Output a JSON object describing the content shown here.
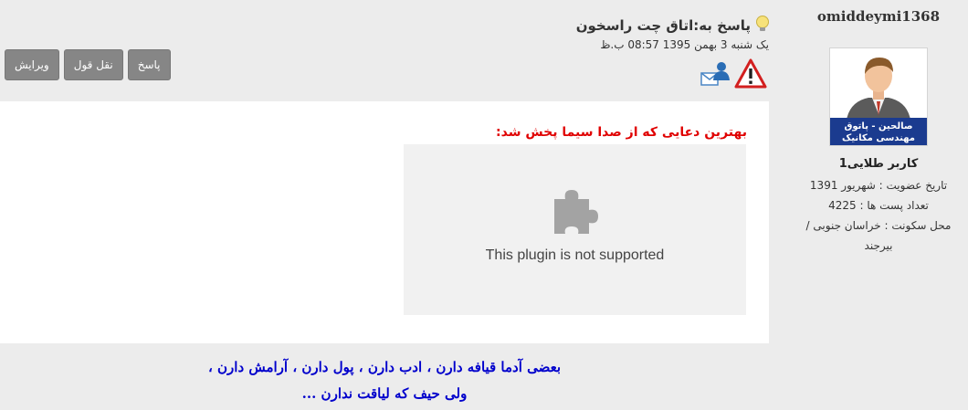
{
  "user": {
    "username": "omiddeymi1368",
    "avatar_caption_line1": "صالحین - پاتوق",
    "avatar_caption_line2": "مهندسی مکانیک",
    "rank": "کاربر طلایی1",
    "join_date": "تاریخ عضویت : شهریور 1391",
    "post_count": "تعداد پست ها : 4225",
    "location_line1": "محل سکونت : خراسان جنوبی /",
    "location_line2": "بیرجند"
  },
  "post": {
    "title": "پاسخ به:اتاق چت راسخون",
    "date": "یک شنبه 3 بهمن 1395  08:57 ب.ظ",
    "report_icon": "warning-icon",
    "pm_icon": "message-user-icon",
    "title_icon": "lightbulb-icon"
  },
  "buttons": {
    "reply": "پاسخ",
    "quote": "نقل قول",
    "edit": "ویرایش"
  },
  "content": {
    "red_text": "بهترین دعایی که از صدا سیما پخش شد:",
    "plugin_icon": "puzzle-icon",
    "plugin_message": "This plugin is not supported"
  },
  "signature": {
    "line1": "بعضی آدما قیافه دارن ، ادب دارن ، پول دارن ، آرامش دارن ،",
    "line2": "ولی حیف که لیاقت ندارن ..."
  },
  "colors": {
    "red_text": "#e00000",
    "signature": "#0000cc",
    "button_bg": "#868686"
  }
}
